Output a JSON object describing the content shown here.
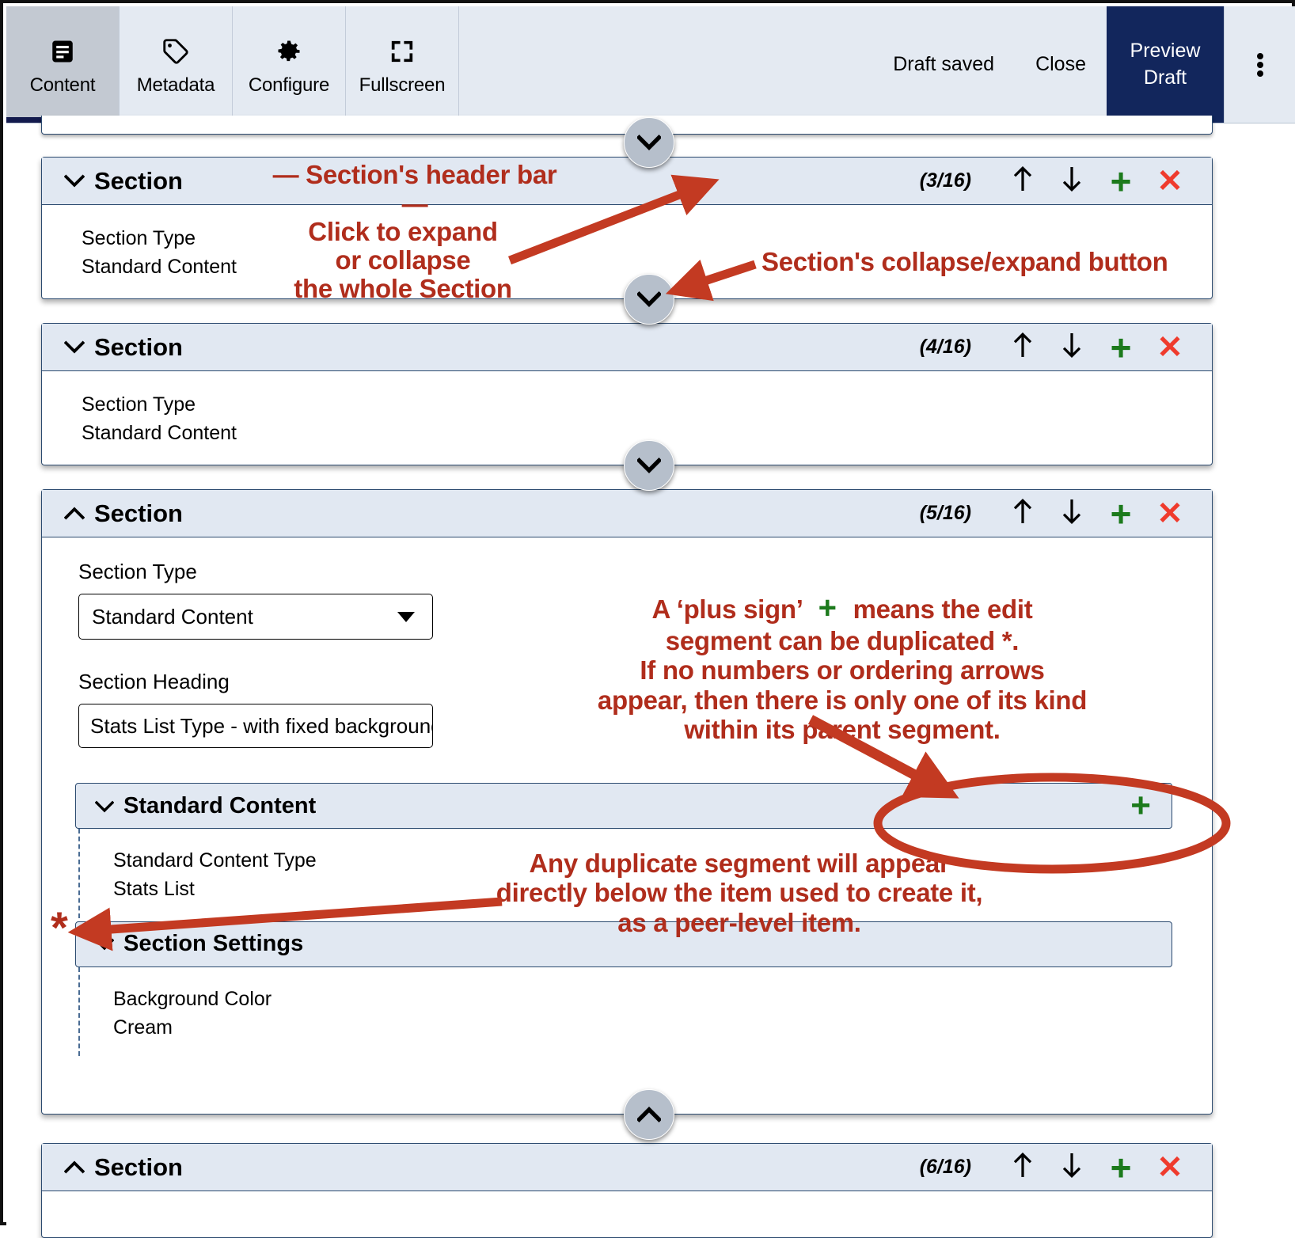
{
  "toolbar": {
    "tabs": [
      {
        "label": "Content",
        "icon": "document-icon",
        "active": true
      },
      {
        "label": "Metadata",
        "icon": "tag-icon",
        "active": false
      },
      {
        "label": "Configure",
        "icon": "gear-icon",
        "active": false
      },
      {
        "label": "Fullscreen",
        "icon": "fullscreen-icon",
        "active": false
      }
    ],
    "draft_status": "Draft saved",
    "close_label": "Close",
    "preview_line1": "Preview",
    "preview_line2": "Draft",
    "overflow_icon": "kebab-menu-icon",
    "accent_navy": "#12265c"
  },
  "sections": [
    {
      "title": "Section",
      "counter": "(3/16)",
      "expanded": false,
      "chevron": "chevron-down-icon",
      "fields": [
        {
          "label": "Section Type",
          "value": "Standard Content"
        }
      ]
    },
    {
      "title": "Section",
      "counter": "(4/16)",
      "expanded": false,
      "chevron": "chevron-down-icon",
      "fields": [
        {
          "label": "Section Type",
          "value": "Standard Content"
        }
      ]
    },
    {
      "title": "Section",
      "counter": "(5/16)",
      "expanded": true,
      "chevron": "chevron-up-icon",
      "form": {
        "section_type_label": "Section Type",
        "section_type_value": "Standard Content",
        "section_heading_label": "Section Heading",
        "section_heading_value": "Stats List Type - with fixed background image"
      },
      "sub_panels": [
        {
          "title": "Standard Content",
          "has_plus": true,
          "fields": [
            {
              "label": "Standard Content Type",
              "value": "Stats List"
            }
          ]
        },
        {
          "title": "Section Settings",
          "has_plus": false,
          "fields": [
            {
              "label": "Background Color",
              "value": "Cream"
            }
          ]
        }
      ]
    },
    {
      "title": "Section",
      "counter": "(6/16)",
      "expanded": true,
      "chevron": "chevron-up-icon",
      "fields": []
    }
  ],
  "section_controls": {
    "move_up": "arrow-up-icon",
    "move_down": "arrow-down-icon",
    "add": "plus-icon",
    "remove": "close-icon",
    "plus_color": "#1c7a1c",
    "close_color": "#ef3b2d"
  },
  "annotations": {
    "color": "#b02d1c",
    "header_bar": "— Section's header bar —",
    "click_expand": [
      "Click to expand",
      "or collapse",
      "the whole Section"
    ],
    "collapse_button": "Section's collapse/expand button",
    "plus_sign_note": [
      "A 'plus sign'        means the edit",
      "segment can be duplicated *.",
      "If no numbers or ordering arrows",
      "appear, then there is only one of its kind",
      "within its parent segment."
    ],
    "plus_sign_note_line1_a": "A ‘plus sign’",
    "plus_sign_note_line1_b": "means the edit",
    "plus_sign_note_line2": "segment can be duplicated *.",
    "plus_sign_note_line3": "If no numbers or ordering arrows",
    "plus_sign_note_line4": "appear, then there is only one of its kind",
    "plus_sign_note_line5": "within its parent segment.",
    "duplicate_note": [
      "Any duplicate segment will appear",
      "directly below the item used to create it,",
      "as a peer-level item."
    ],
    "duplicate_note_line1": "Any duplicate segment will appear",
    "duplicate_note_line2": "directly below the item used to create it,",
    "duplicate_note_line3": "as a peer-level item.",
    "asterisk": "*",
    "inline_plus_glyph": "+"
  }
}
